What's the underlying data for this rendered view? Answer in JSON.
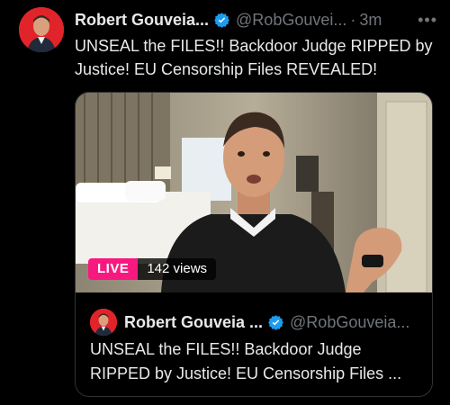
{
  "tweet": {
    "author_name": "Robert Gouveia...",
    "handle": "@RobGouvei...",
    "separator": "·",
    "time": "3m",
    "more_label": "•••",
    "text": "UNSEAL the FILES!! Backdoor Judge RIPPED by Justice! EU Censorship Files REVEALED!"
  },
  "media": {
    "live_label": "LIVE",
    "views": "142 views"
  },
  "quoted": {
    "author_name": "Robert Gouveia ...",
    "handle": "@RobGouveia...",
    "text": "UNSEAL the FILES!! Backdoor Judge RIPPED by Justice! EU Censorship Files ..."
  },
  "colors": {
    "background": "#000000",
    "text": "#e7e9ea",
    "muted": "#71767b",
    "verified": "#1d9bf0",
    "live": "#f91880",
    "avatar_bg": "#e0242a"
  },
  "icons": {
    "verified": "verified-badge-icon",
    "more": "more-icon"
  }
}
